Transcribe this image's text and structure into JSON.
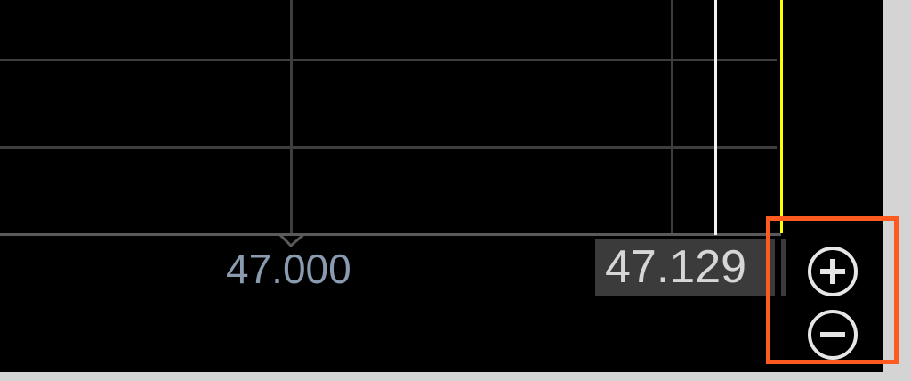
{
  "chart": {
    "x_tick_label": "47.000",
    "current_price_label": "47.129",
    "colors": {
      "background": "#000000",
      "grid": "#3e3e3e",
      "axis": "#5a5a5a",
      "tick_text": "#8a9bb0",
      "price_marker_line": "#f2f2f2",
      "cursor_line": "#ffff00",
      "price_label_bg": "#3b3b3b",
      "price_label_text": "#d6d6d6",
      "highlight_box": "#ff5a1f"
    }
  },
  "zoom_controls": {
    "zoom_in_icon": "plus-circle-icon",
    "zoom_out_icon": "minus-circle-icon"
  }
}
